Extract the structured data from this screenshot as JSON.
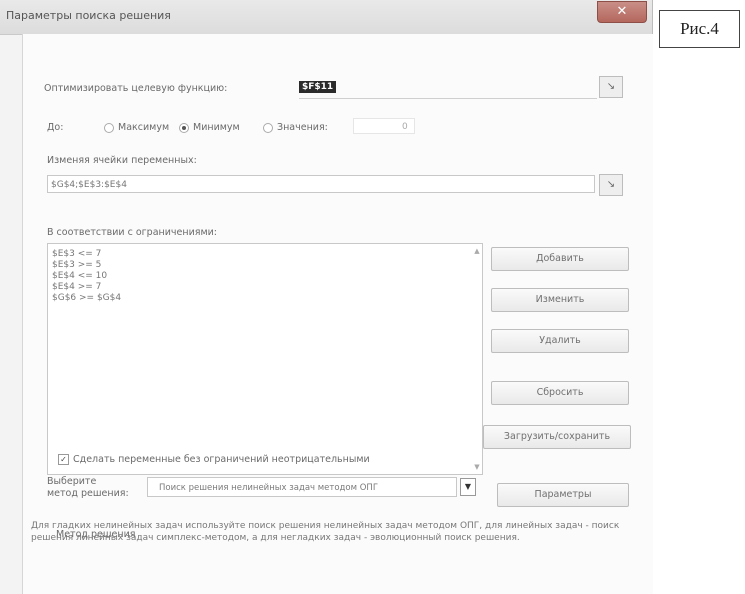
{
  "window": {
    "title": "Параметры поиска решения",
    "close_glyph": "✕"
  },
  "figure_label": "Рис.4",
  "objective": {
    "label": "Оптимизировать целевую функцию:",
    "value": "$F$11",
    "ref_icon": "range-select-icon"
  },
  "to": {
    "label": "До:",
    "options": [
      {
        "label": "Максимум",
        "selected": false
      },
      {
        "label": "Минимум",
        "selected": true
      },
      {
        "label": "Значения:",
        "selected": false
      }
    ],
    "value": "0"
  },
  "variables": {
    "label": "Изменяя ячейки переменных:",
    "value": "$G$4;$E$3:$E$4"
  },
  "constraints": {
    "label": "В соответствии с ограничениями:",
    "items": [
      "$E$3 <= 7",
      "$E$3 >= 5",
      "$E$4 <= 10",
      "$E$4 >= 7",
      "$G$6 >= $G$4"
    ]
  },
  "buttons": {
    "add": "Добавить",
    "change": "Изменить",
    "delete": "Удалить",
    "reset": "Сбросить",
    "load_save": "Загрузить/сохранить",
    "options": "Параметры"
  },
  "nonneg": {
    "label": "Сделать переменные без ограничений неотрицательными",
    "checked": true
  },
  "method": {
    "label_line1": "Выберите",
    "label_line2": "метод решения:",
    "value": "Поиск решения нелинейных задач методом ОПГ"
  },
  "method_info": {
    "heading": "Метод решения",
    "text": "Для гладких нелинейных задач используйте поиск решения нелинейных задач методом ОПГ, для линейных задач - поиск решения линейных задач симплекс-методом, а для негладких задач - эволюционный поиск решения."
  },
  "colors": {
    "selection": "#2b2b2b",
    "close_button": "#b4675d"
  }
}
